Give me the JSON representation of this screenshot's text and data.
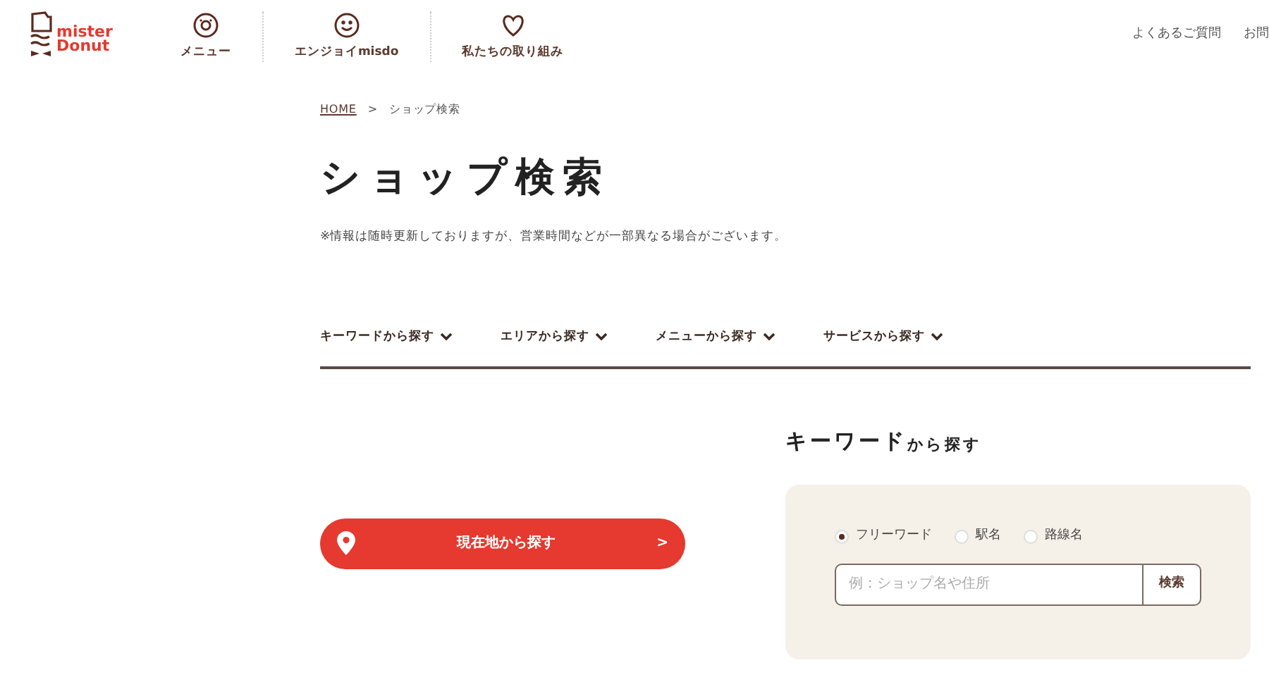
{
  "header": {
    "logo": {
      "line_1": "mister",
      "line_2": "Donut"
    },
    "nav": [
      {
        "label": "メニュー"
      },
      {
        "label": "エンジョイmisdo"
      },
      {
        "label": "私たちの取り組み"
      }
    ],
    "links": [
      "よくあるご質問",
      "お問"
    ]
  },
  "breadcrumb": [
    {
      "label": "HOME",
      "kind": "link"
    },
    {
      "label": ">",
      "kind": "text"
    },
    {
      "label": "ショップ検索",
      "kind": "text"
    }
  ],
  "title": "ショップ検索",
  "notice": "※情報は随時更新しておりますが、営業時間などが一部異なる場合がございます。",
  "tabs": [
    {
      "label": "キーワードから探す"
    },
    {
      "label": "エリアから探す"
    },
    {
      "label": "メニューから探す"
    },
    {
      "label": "サービスから探す"
    }
  ],
  "location_button": {
    "label": "現在地から探す",
    "arrow": ">"
  },
  "keyword_search": {
    "heading_main": "キーワード",
    "heading_suffix": "から探す",
    "options": [
      {
        "label": "フリーワード",
        "selected": true
      },
      {
        "label": "駅名",
        "selected": false
      },
      {
        "label": "路線名",
        "selected": false
      }
    ],
    "placeholder": "例：ショップ名や住所",
    "button": "検索"
  }
}
